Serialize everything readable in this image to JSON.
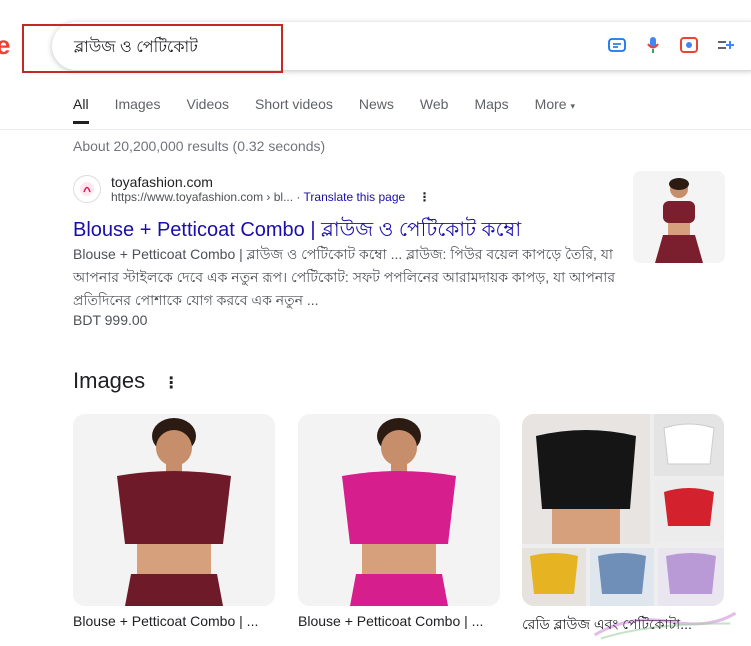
{
  "search": {
    "query": "ব্লাউজ ও পেটিকোট"
  },
  "tabs": [
    {
      "label": "All"
    },
    {
      "label": "Images"
    },
    {
      "label": "Videos"
    },
    {
      "label": "Short videos"
    },
    {
      "label": "News"
    },
    {
      "label": "Web"
    },
    {
      "label": "Maps"
    },
    {
      "label": "More"
    }
  ],
  "results_count": "About 20,200,000 results (0.32 seconds)",
  "result": {
    "site_name": "toyafashion.com",
    "url": "https://www.toyafashion.com › bl...",
    "translate": "Translate this page",
    "title": "Blouse + Petticoat Combo | ব্লাউজ ও পেটিকোট কম্বো",
    "snippet": "Blouse + Petticoat Combo | ব্লাউজ ও পেটিকোট কম্বো ... ব্লাউজ: পিউর বয়েল কাপড়ে তৈরি, যা আপনার স্টাইলকে দেবে এক নতুন রূপ। পেটিকোট: সফট পপলিনের আরামদায়ক কাপড়, যা আপনার প্রতিদিনের পোশাকে যোগ করবে এক নতুন ...",
    "price": "BDT 999.00"
  },
  "images_section": {
    "heading": "Images",
    "items": [
      {
        "caption": "Blouse + Petticoat Combo | ..."
      },
      {
        "caption": "Blouse + Petticoat Combo | ..."
      },
      {
        "caption": "রেডি ব্লাউজ এবং পেটিকোটা..."
      }
    ]
  },
  "colors": {
    "link": "#1a0dab",
    "highlight": "#c62828",
    "text_muted": "#4d5156"
  }
}
